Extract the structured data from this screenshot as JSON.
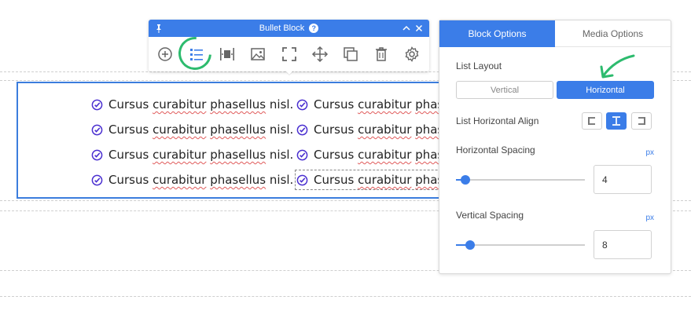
{
  "bullets": {
    "text_pre": "Cursus ",
    "text_u1": "curabitur",
    "text_mid": " ",
    "text_u2": "phasellus",
    "text_post": " nisl.",
    "text_trunc_post": " phas"
  },
  "toolbar": {
    "title": "Bullet Block",
    "help_label": "?",
    "icons": [
      "pin-icon",
      "add-icon",
      "list-icon",
      "spacing-icon",
      "image-icon",
      "fullscreen-icon",
      "move-icon",
      "duplicate-icon",
      "trash-icon",
      "gear-icon",
      "collapse-icon",
      "close-icon"
    ]
  },
  "panel": {
    "tabs": [
      {
        "label": "Block Options",
        "active": true
      },
      {
        "label": "Media Options",
        "active": false
      }
    ],
    "list_layout": {
      "label": "List Layout",
      "options": [
        "Vertical",
        "Horizontal"
      ],
      "selected": "Horizontal"
    },
    "horizontal_align": {
      "label": "List Horizontal Align",
      "options": [
        "left",
        "center",
        "right"
      ],
      "selected": "center"
    },
    "horizontal_spacing": {
      "label": "Horizontal Spacing",
      "unit": "px",
      "value": "4",
      "slider_fraction": 0.04
    },
    "vertical_spacing": {
      "label": "Vertical Spacing",
      "unit": "px",
      "value": "8",
      "slider_fraction": 0.08
    }
  },
  "colors": {
    "accent": "#3b7de8",
    "highlight": "#2dbb6e",
    "check": "#4a2fd0"
  }
}
